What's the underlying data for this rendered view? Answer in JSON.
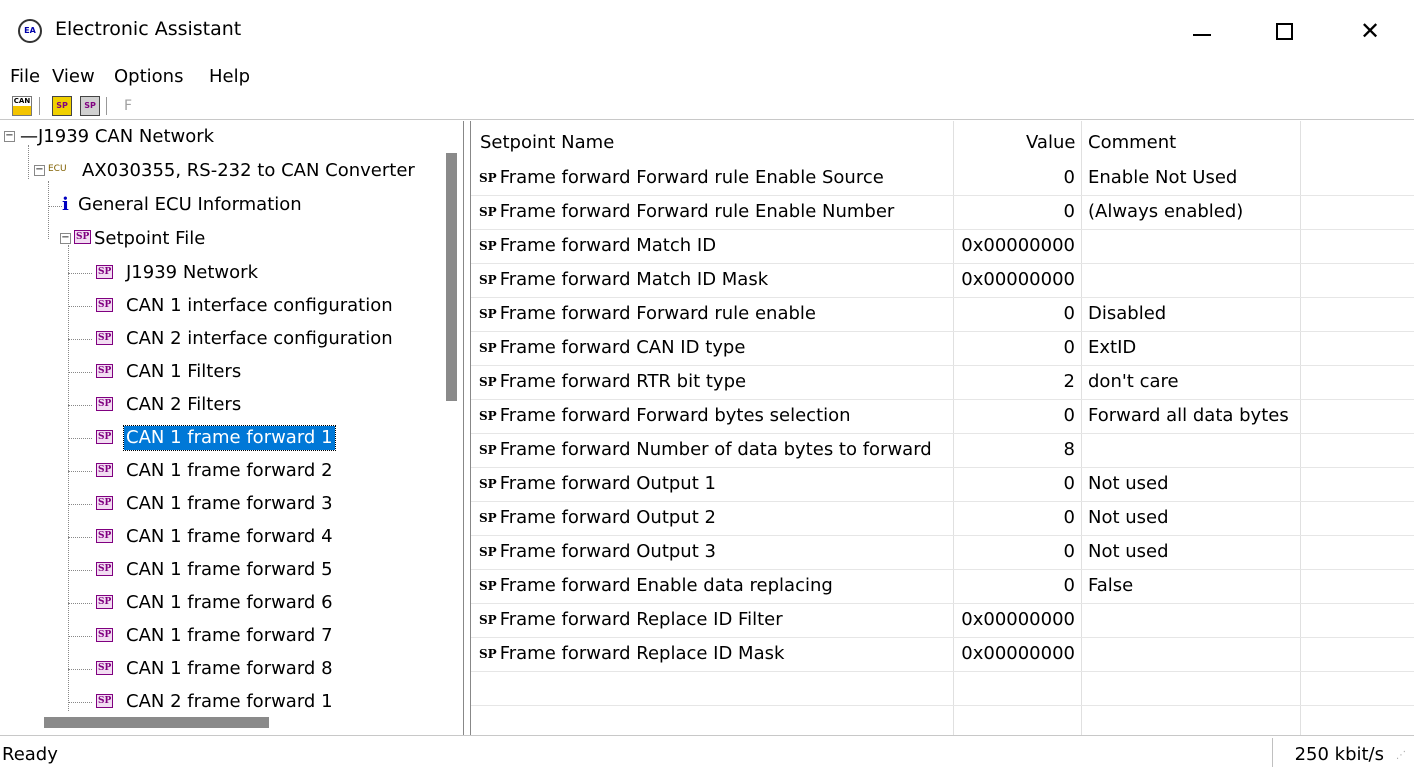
{
  "window": {
    "title": "Electronic Assistant",
    "icon": "app-logo-icon",
    "icon_text": "EA",
    "controls": [
      "minimize-icon",
      "maximize-icon",
      "close-icon"
    ],
    "close_glyph": "✕"
  },
  "menu": {
    "items": [
      "File",
      "View",
      "Options",
      "Help"
    ]
  },
  "toolbar": {
    "buttons": [
      {
        "name": "can-network-icon",
        "text": "CAN"
      },
      {
        "name": "open-setpoint-icon",
        "text": "SP"
      },
      {
        "name": "save-setpoint-icon",
        "text": "SP"
      },
      {
        "name": "flash-icon",
        "text": "F"
      }
    ]
  },
  "tree": {
    "root": "J1939 CAN Network",
    "ecu_prefix": "ECU",
    "ecu": "AX030355, RS-232 to CAN Converter",
    "info_icon_text": "i",
    "info": "General ECU Information",
    "setpoint_file": "Setpoint File",
    "sp_icon_text": "SP",
    "children": [
      "J1939 Network",
      "CAN 1 interface configuration",
      "CAN 2 interface configuration",
      "CAN 1 Filters",
      "CAN 2 Filters",
      "CAN 1 frame forward 1",
      "CAN 1 frame forward 2",
      "CAN 1 frame forward 3",
      "CAN 1 frame forward 4",
      "CAN 1 frame forward 5",
      "CAN 1 frame forward 6",
      "CAN 1 frame forward 7",
      "CAN 1 frame forward 8",
      "CAN 2 frame forward 1"
    ],
    "selected": "CAN 1 frame forward 1"
  },
  "grid": {
    "columns": [
      "Setpoint Name",
      "Value",
      "Comment"
    ],
    "row_prefix": "SP",
    "rows": [
      {
        "name": "Frame forward Forward rule Enable Source",
        "value": "0",
        "comment": "Enable Not Used"
      },
      {
        "name": "Frame forward Forward rule Enable Number",
        "value": "0",
        "comment": "(Always enabled)"
      },
      {
        "name": "Frame forward Match ID",
        "value": "0x00000000",
        "comment": ""
      },
      {
        "name": "Frame forward Match ID Mask",
        "value": "0x00000000",
        "comment": ""
      },
      {
        "name": "Frame forward Forward rule enable",
        "value": "0",
        "comment": "Disabled"
      },
      {
        "name": "Frame forward CAN ID type",
        "value": "0",
        "comment": "ExtID"
      },
      {
        "name": "Frame forward RTR bit type",
        "value": "2",
        "comment": "don't care"
      },
      {
        "name": "Frame forward Forward bytes selection",
        "value": "0",
        "comment": "Forward all data bytes"
      },
      {
        "name": "Frame forward Number of data bytes to forward",
        "value": "8",
        "comment": ""
      },
      {
        "name": "Frame forward Output 1",
        "value": "0",
        "comment": "Not used"
      },
      {
        "name": "Frame forward Output 2",
        "value": "0",
        "comment": "Not used"
      },
      {
        "name": "Frame forward Output 3",
        "value": "0",
        "comment": "Not used"
      },
      {
        "name": "Frame forward Enable data replacing",
        "value": "0",
        "comment": "False"
      },
      {
        "name": "Frame forward Replace ID Filter",
        "value": "0x00000000",
        "comment": ""
      },
      {
        "name": "Frame forward Replace ID Mask",
        "value": "0x00000000",
        "comment": ""
      }
    ]
  },
  "status": {
    "text": "Ready",
    "rate": "250 kbit/s"
  },
  "colors": {
    "selection": "#0078d7",
    "sp_icon": "#800080"
  }
}
